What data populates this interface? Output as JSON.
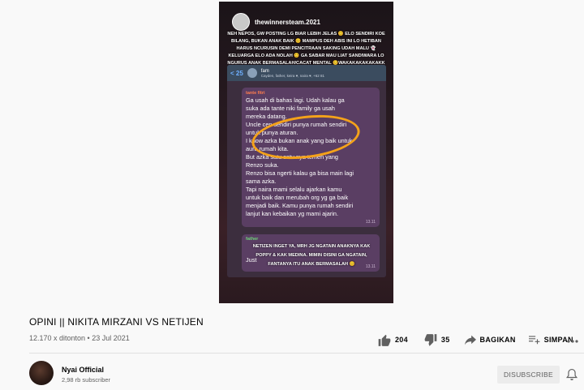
{
  "video": {
    "ig_username": "thewinnersteam.2021",
    "ig_caption": "NEH NEPOS, GW POSTING LG BIAR LEBIH JELAS 😊 ELO SENDIRI KOE BILANG, BUKAN ANAK BAIK 😊 MAMPUS DEH ABIS INI LO HETIBAN HARUS NCURUSIN DEMI PENCITRAAN SAKING UDAH MALU 👻 KELUARGA ELO ADA NOLAH 😊 GA SABAR MAU LIAT SANDIWARA LO NGURUS ANAK BERMASALAH/CACAT MENTAL 😊WAKAKAKAKAKAKK 😊",
    "chat_back": "< 25",
    "chat_title": "fam",
    "chat_subtitle": "Cayden, father, keira ♥, naira ♥, +62 81",
    "sender1": "tante fitri",
    "message1": "Ga usah di bahas lagi. Udah kalau ga\nsuka ada tante niki family ga usah\nmereka datang.\nUncle cen sendiri punya rumah sendiri\nuntuk punya aturan.\nI know azka bukan anak yang baik untuk\naura rumah kita.\nBut azka satu satu nya temen yang\nRenzo suka.\nRenzo bisa ngerti kalau ga bisa main lagi\nsama azka.\nTapi naira mami selalu ajarkan kamu\nuntuk baik dan merubah org yg ga baik\nmenjadi baik. Kamu punya rumah sendiri\nlanjut kan kebaikan yg mami ajarin.",
    "time1": "13.11",
    "sender2": "father",
    "message2": "Just",
    "time2": "13.11",
    "overlay2": "NETIZEN INGET YA, MRH JG NGATAIN ANAKNYA KAK POPPY & KAK MEDINA. MIMIN DISINI GA NGATAIN, FANTANYA ITU ANAK BERMASALAH 😊"
  },
  "title": "OPINI || NIKITA MIRZANI VS NETIJEN",
  "meta": "12.170 x ditonton • 23 Jul 2021",
  "actions": {
    "likes": "204",
    "dislikes": "35",
    "share": "BAGIKAN",
    "save": "SIMPAN"
  },
  "channel": {
    "name": "Nyai Official",
    "subscribers": "2,98 rb subscriber",
    "subscribe_label": "DISUBSCRIBE"
  },
  "colors": {
    "background": "#f9f9f9",
    "subscribe_bg": "#ececec",
    "secondary_text": "#606060",
    "circle_highlight": "#f4a21a"
  }
}
